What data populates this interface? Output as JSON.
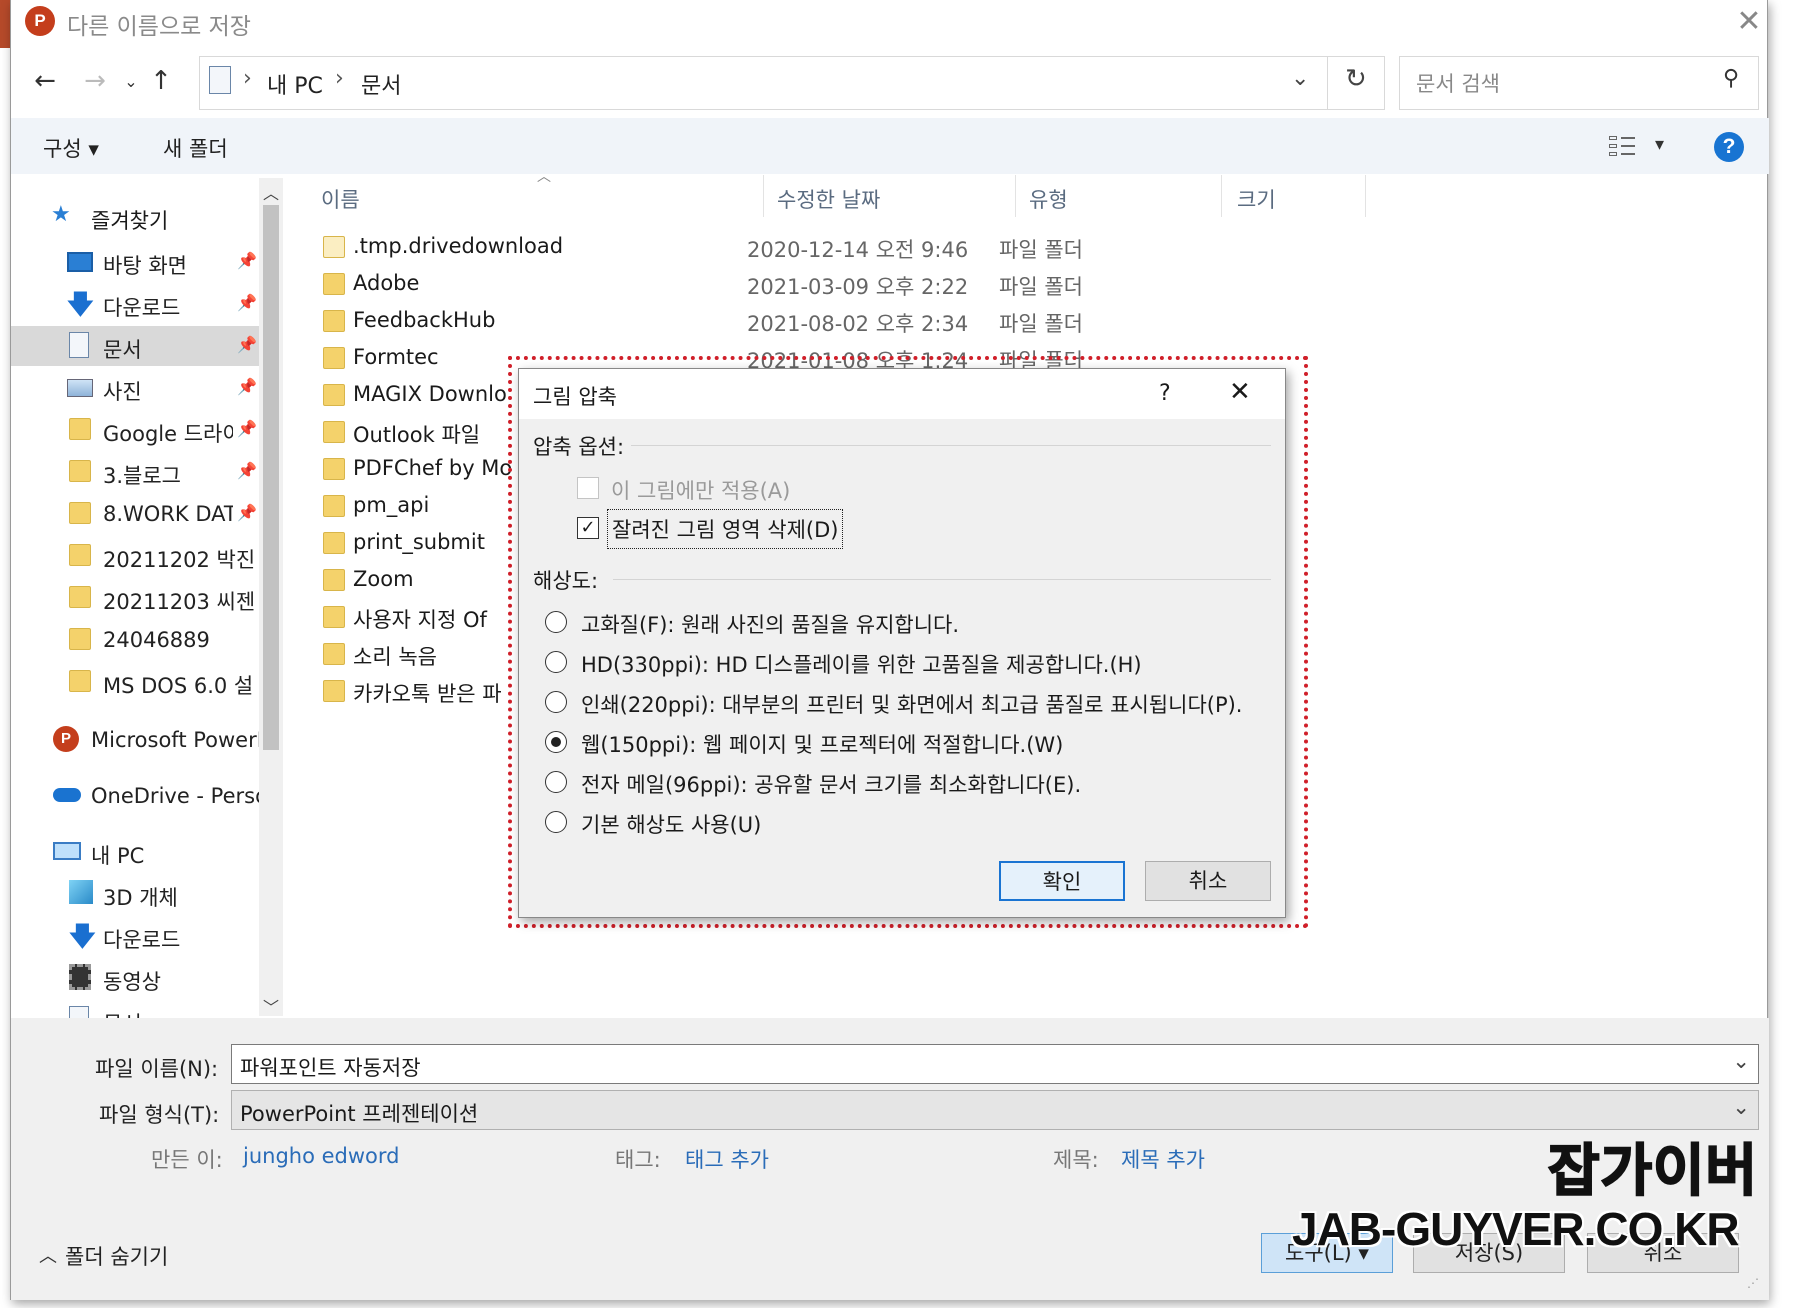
{
  "window": {
    "title": "다른 이름으로 저장",
    "app_icon": "P"
  },
  "address": {
    "crumbs": [
      "내 PC",
      "문서"
    ],
    "search_placeholder": "문서 검색"
  },
  "toolbar": {
    "organize": "구성 ▾",
    "new_folder": "새 폴더",
    "help": "?"
  },
  "nav": {
    "quick_access": "즐겨찾기",
    "items": [
      {
        "label": "바탕 화면",
        "icon": "desktop-icon",
        "pinned": true
      },
      {
        "label": "다운로드",
        "icon": "download-arrow-icon",
        "pinned": true
      },
      {
        "label": "문서",
        "icon": "document-icon",
        "pinned": true,
        "selected": true
      },
      {
        "label": "사진",
        "icon": "picture-icon",
        "pinned": true
      },
      {
        "label": "Google 드라이",
        "icon": "folder-icon",
        "pinned": true
      },
      {
        "label": "3.블로그",
        "icon": "folder-icon",
        "pinned": true
      },
      {
        "label": "8.WORK DAT",
        "icon": "folder-icon",
        "pinned": true
      },
      {
        "label": "20211202 박진",
        "icon": "folder-icon",
        "pinned": false
      },
      {
        "label": "20211203 씨젠",
        "icon": "folder-icon",
        "pinned": false
      },
      {
        "label": "24046889",
        "icon": "folder-icon",
        "pinned": false
      },
      {
        "label": "MS DOS 6.0 설",
        "icon": "folder-icon",
        "pinned": false
      }
    ],
    "powerpoint": "Microsoft PowerP",
    "onedrive": "OneDrive - Persor",
    "this_pc": "내 PC",
    "pc_items": [
      {
        "label": "3D 개체",
        "icon": "3d-objects-icon"
      },
      {
        "label": "다운로드",
        "icon": "download-arrow-icon"
      },
      {
        "label": "동영상",
        "icon": "video-icon"
      },
      {
        "label": "문서",
        "icon": "document-icon"
      }
    ]
  },
  "list": {
    "headers": {
      "name": "이름",
      "date": "수정한 날짜",
      "type": "유형",
      "size": "크기"
    },
    "rows": [
      {
        "name": ".tmp.drivedownload",
        "date": "2020-12-14 오전 9:46",
        "type": "파일 폴더"
      },
      {
        "name": "Adobe",
        "date": "2021-03-09 오후 2:22",
        "type": "파일 폴더"
      },
      {
        "name": "FeedbackHub",
        "date": "2021-08-02 오후 2:34",
        "type": "파일 폴더"
      },
      {
        "name": "Formtec",
        "date": "2021-01-08 오후 1:24",
        "type": "파일 폴더"
      },
      {
        "name": "MAGIX Downlo",
        "date": "",
        "type": ""
      },
      {
        "name": "Outlook 파일",
        "date": "",
        "type": ""
      },
      {
        "name": "PDFChef by Mo",
        "date": "",
        "type": ""
      },
      {
        "name": "pm_api",
        "date": "",
        "type": ""
      },
      {
        "name": "print_submit",
        "date": "",
        "type": ""
      },
      {
        "name": "Zoom",
        "date": "",
        "type": ""
      },
      {
        "name": "사용자 지정 Of",
        "date": "",
        "type": ""
      },
      {
        "name": "소리 녹음",
        "date": "",
        "type": ""
      },
      {
        "name": "카카오톡 받은 파",
        "date": "",
        "type": ""
      }
    ]
  },
  "bottom": {
    "filename_label": "파일 이름(N):",
    "filename_value": "파워포인트 자동저장",
    "filetype_label": "파일 형식(T):",
    "filetype_value": "PowerPoint 프레젠테이션",
    "author_label": "만든 이:",
    "author_value": "jungho edword",
    "tags_label": "태그:",
    "tags_value": "태그 추가",
    "title_label": "제목:",
    "title_value": "제목 추가",
    "hide_folders": "폴더 숨기기",
    "tools": "도구(L)",
    "save": "저장(S)",
    "cancel": "취소"
  },
  "dialog": {
    "title": "그림 압축",
    "help": "?",
    "compress_options_label": "압축 옵션:",
    "apply_only_this": "이 그림에만 적용(A)",
    "apply_only_this_checked": false,
    "delete_cropped": "잘려진 그림 영역 삭제(D)",
    "delete_cropped_checked": true,
    "resolution_label": "해상도:",
    "options": [
      {
        "label": "고화질(F): 원래 사진의 품질을 유지합니다.",
        "selected": false
      },
      {
        "label": "HD(330ppi): HD 디스플레이를 위한 고품질을 제공합니다.(H)",
        "selected": false
      },
      {
        "label": "인쇄(220ppi): 대부분의 프린터 및 화면에서 최고급 품질로 표시됩니다(P).",
        "selected": false
      },
      {
        "label": "웹(150ppi): 웹 페이지 및 프로젝터에 적절합니다.(W)",
        "selected": true
      },
      {
        "label": "전자 메일(96ppi): 공유할 문서 크기를 최소화합니다(E).",
        "selected": false
      },
      {
        "label": "기본 해상도 사용(U)",
        "selected": false
      }
    ],
    "ok": "확인",
    "cancel": "취소"
  },
  "watermark": {
    "korean": "잡가이버",
    "domain": "JAB-GUYVER.CO.KR"
  },
  "colors": {
    "accent": "#1874d2",
    "highlight_outline": "#d0202a",
    "link": "#2a6cb8",
    "powerpoint": "#c43e1c"
  }
}
